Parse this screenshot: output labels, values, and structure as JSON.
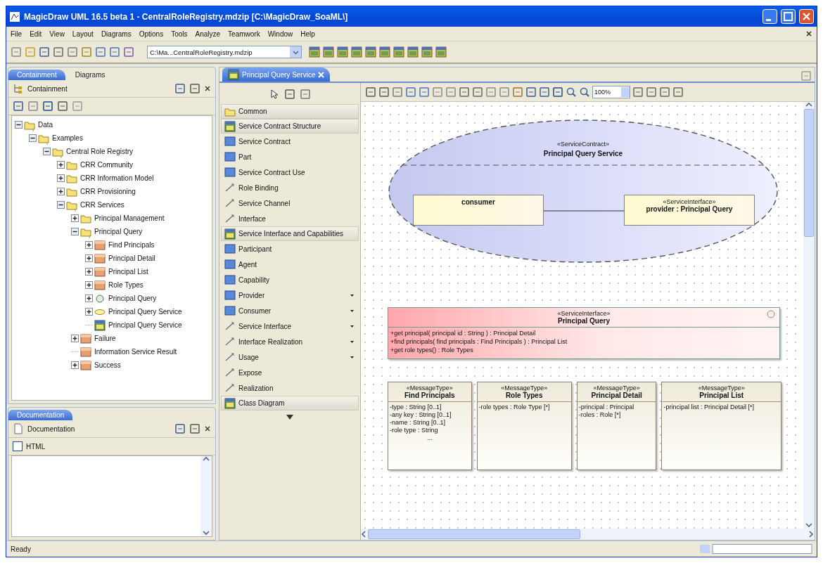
{
  "window": {
    "title": "MagicDraw UML 16.5 beta 1 - CentralRoleRegistry.mdzip [C:\\MagicDraw_SoaML\\]"
  },
  "menu": [
    "File",
    "Edit",
    "View",
    "Layout",
    "Diagrams",
    "Options",
    "Tools",
    "Analyze",
    "Teamwork",
    "Window",
    "Help"
  ],
  "project_selector": {
    "value": "C:\\Ma...CentralRoleRegistry.mdzip"
  },
  "browser_tabs": [
    {
      "label": "Containment",
      "selected": true
    },
    {
      "label": "Diagrams",
      "selected": false
    }
  ],
  "containment": {
    "title": "Containment",
    "tree": [
      {
        "label": "Data",
        "kind": "package",
        "expandable": true,
        "expanded": true,
        "children": [
          {
            "label": "Examples",
            "kind": "package",
            "expandable": true,
            "expanded": true,
            "children": [
              {
                "label": "Central Role Registry",
                "kind": "package",
                "expandable": true,
                "expanded": true,
                "children": [
                  {
                    "label": "CRR Community",
                    "kind": "package",
                    "expandable": true,
                    "expanded": false
                  },
                  {
                    "label": "CRR Information Model",
                    "kind": "package",
                    "expandable": true,
                    "expanded": false
                  },
                  {
                    "label": "CRR Provisioning",
                    "kind": "package",
                    "expandable": true,
                    "expanded": false
                  },
                  {
                    "label": "CRR Services",
                    "kind": "package",
                    "expandable": true,
                    "expanded": true,
                    "children": [
                      {
                        "label": "Principal Management",
                        "kind": "package",
                        "expandable": true,
                        "expanded": false
                      },
                      {
                        "label": "Principal Query",
                        "kind": "package",
                        "expandable": true,
                        "expanded": true,
                        "children": [
                          {
                            "label": "Find Principals",
                            "kind": "class",
                            "expandable": true,
                            "expanded": false
                          },
                          {
                            "label": "Principal Detail",
                            "kind": "class",
                            "expandable": true,
                            "expanded": false
                          },
                          {
                            "label": "Principal List",
                            "kind": "class",
                            "expandable": true,
                            "expanded": false
                          },
                          {
                            "label": "Role Types",
                            "kind": "class",
                            "expandable": true,
                            "expanded": false
                          },
                          {
                            "label": "Principal Query",
                            "kind": "interface",
                            "expandable": true,
                            "expanded": false
                          },
                          {
                            "label": "Principal Query Service",
                            "kind": "contract",
                            "expandable": true,
                            "expanded": false
                          },
                          {
                            "label": "Principal Query Service",
                            "kind": "diagram",
                            "expandable": false
                          }
                        ]
                      },
                      {
                        "label": "Failure",
                        "kind": "class",
                        "expandable": true,
                        "expanded": false
                      },
                      {
                        "label": "Information Service Result",
                        "kind": "class",
                        "expandable": false
                      },
                      {
                        "label": "Success",
                        "kind": "class",
                        "expandable": true,
                        "expanded": false
                      }
                    ]
                  }
                ]
              }
            ]
          }
        ]
      }
    ]
  },
  "documentation": {
    "tab": "Documentation",
    "title": "Documentation",
    "html": {
      "label": "HTML",
      "checked": false
    }
  },
  "editor_tab": {
    "label": "Principal Query Service"
  },
  "palette": [
    {
      "label": "Common",
      "kind": "group",
      "submenu": false
    },
    {
      "label": "Service Contract Structure",
      "kind": "group",
      "submenu": false
    },
    {
      "label": "Service Contract",
      "kind": "element",
      "submenu": false
    },
    {
      "label": "Part",
      "kind": "element",
      "submenu": false
    },
    {
      "label": "Service Contract Use",
      "kind": "element",
      "submenu": false
    },
    {
      "label": "Role Binding",
      "kind": "relation",
      "submenu": false
    },
    {
      "label": "Service Channel",
      "kind": "relation",
      "submenu": false
    },
    {
      "label": "Interface",
      "kind": "relation",
      "submenu": false
    },
    {
      "label": "Service Interface and Capabilities",
      "kind": "group",
      "submenu": false
    },
    {
      "label": "Participant",
      "kind": "element",
      "submenu": false
    },
    {
      "label": "Agent",
      "kind": "element",
      "submenu": false
    },
    {
      "label": "Capability",
      "kind": "element",
      "submenu": false
    },
    {
      "label": "Provider",
      "kind": "element",
      "submenu": true
    },
    {
      "label": "Consumer",
      "kind": "element",
      "submenu": true
    },
    {
      "label": "Service Interface",
      "kind": "relation",
      "submenu": true
    },
    {
      "label": "Interface Realization",
      "kind": "relation",
      "submenu": true
    },
    {
      "label": "Usage",
      "kind": "relation",
      "submenu": true
    },
    {
      "label": "Expose",
      "kind": "relation",
      "submenu": false
    },
    {
      "label": "Realization",
      "kind": "relation",
      "submenu": false
    },
    {
      "label": "Class Diagram",
      "kind": "group",
      "submenu": false
    }
  ],
  "diagram": {
    "zoom": "100%",
    "contract": {
      "stereotype": "«ServiceContract»",
      "name": "Principal Query Service",
      "parts": [
        {
          "label": "consumer"
        },
        {
          "stereotype": "«ServiceInterface»",
          "label": "provider : Principal Query"
        }
      ]
    },
    "interface": {
      "stereotype": "«ServiceInterface»",
      "name": "Principal Query",
      "operations": [
        "+get principal( principal id : String ) : Principal Detail",
        "+find principals( find principals : Find Principals ) : Principal List",
        "+get role types() : Role Types"
      ]
    },
    "message_types": [
      {
        "stereotype": "«MessageType»",
        "name": "Find Principals",
        "attributes": [
          "-type : String [0..1]",
          "-any key : String [0..1]",
          "-name : String [0..1]",
          "-role type : String"
        ],
        "more": "..."
      },
      {
        "stereotype": "«MessageType»",
        "name": "Role Types",
        "attributes": [
          "-role types : Role Type [*]"
        ]
      },
      {
        "stereotype": "«MessageType»",
        "name": "Principal Detail",
        "attributes": [
          "-principal : Principal",
          "-roles : Role [*]"
        ]
      },
      {
        "stereotype": "«MessageType»",
        "name": "Principal List",
        "attributes": [
          "-principal list : Principal Detail [*]"
        ]
      }
    ]
  },
  "status_bar": {
    "text": "Ready"
  }
}
